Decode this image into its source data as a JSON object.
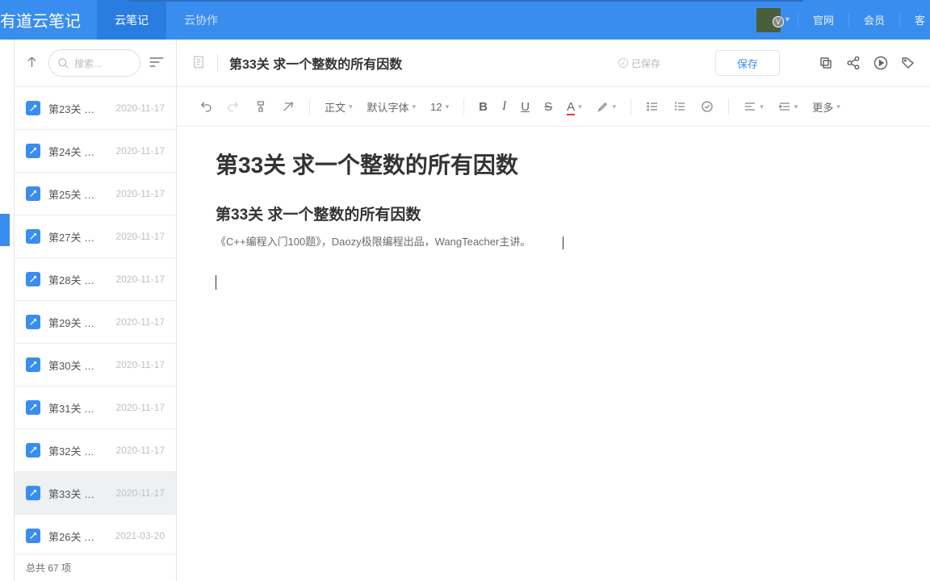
{
  "topbar": {
    "logo": "有道云笔记",
    "tabs": [
      {
        "label": "云笔记",
        "active": true
      },
      {
        "label": "云协作",
        "active": false
      }
    ],
    "avatar_badge": "V",
    "links": [
      "官网",
      "会员",
      "客"
    ]
  },
  "sidebar": {
    "search_placeholder": "搜索...",
    "items": [
      {
        "title": "第23关 …",
        "date": "2020-11-17"
      },
      {
        "title": "第24关 …",
        "date": "2020-11-17"
      },
      {
        "title": "第25关 …",
        "date": "2020-11-17"
      },
      {
        "title": "第27关 …",
        "date": "2020-11-17"
      },
      {
        "title": "第28关 …",
        "date": "2020-11-17"
      },
      {
        "title": "第29关 …",
        "date": "2020-11-17"
      },
      {
        "title": "第30关 …",
        "date": "2020-11-17"
      },
      {
        "title": "第31关 …",
        "date": "2020-11-17"
      },
      {
        "title": "第32关 …",
        "date": "2020-11-17"
      },
      {
        "title": "第33关 …",
        "date": "2020-11-17",
        "selected": true
      },
      {
        "title": "第26关 …",
        "date": "2021-03-20"
      }
    ],
    "footer": "总共 67 项"
  },
  "editor": {
    "title": "第33关 求一个整数的所有因数",
    "saved_label": "已保存",
    "save_btn": "保存",
    "format": {
      "style": "正文",
      "font": "默认字体",
      "size": "12",
      "more": "更多"
    },
    "content": {
      "h1": "第33关 求一个整数的所有因数",
      "h2": "第33关 求一个整数的所有因数",
      "p": "《C++编程入门100题》，Daozy极限编程出品，WangTeacher主讲。"
    }
  }
}
